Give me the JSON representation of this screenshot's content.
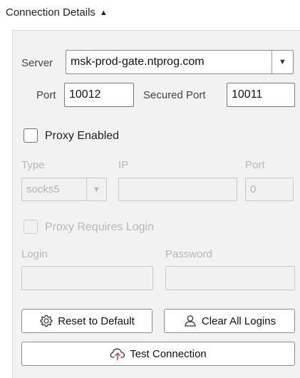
{
  "section": {
    "title": "Connection Details",
    "toggle_glyph": "▲",
    "toggle_icon": "collapse-up-icon"
  },
  "server": {
    "label": "Server",
    "value": "msk-prod-gate.ntprog.com",
    "dropdown_glyph": "▼"
  },
  "ports": {
    "port_label": "Port",
    "port_value": "10012",
    "secured_label": "Secured Port",
    "secured_value": "10011"
  },
  "proxy": {
    "enabled_label": "Proxy Enabled",
    "type_label": "Type",
    "type_value": "socks5",
    "type_dropdown_glyph": "▼",
    "ip_label": "IP",
    "ip_value": "",
    "port_label": "Port",
    "port_value": "0",
    "requires_login_label": "Proxy Requires Login",
    "login_label": "Login",
    "login_value": "",
    "password_label": "Password",
    "password_value": ""
  },
  "buttons": {
    "reset_label": "Reset to Default",
    "reset_icon": "gear-icon",
    "clear_label": "Clear All Logins",
    "clear_icon": "user-icon",
    "test_label": "Test Connection",
    "test_icon": "cloud-upload-icon"
  },
  "colors": {
    "panel_bg": "#f2f2f2",
    "disabled_text": "#b7b7b7",
    "border": "#7a7a7a"
  }
}
